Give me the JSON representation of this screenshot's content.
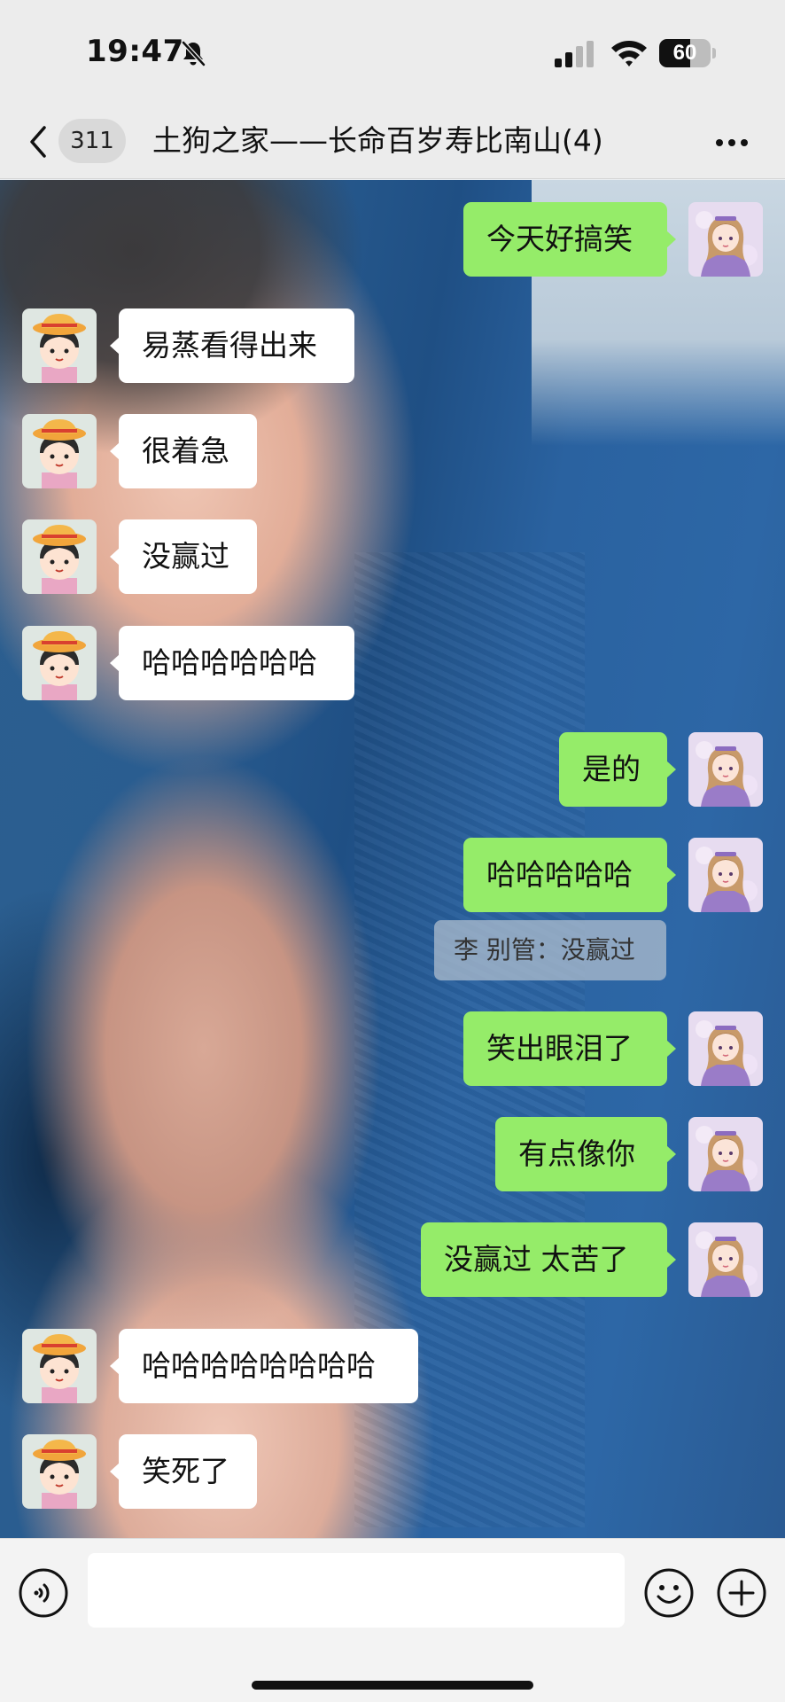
{
  "status_bar": {
    "time": "19:47",
    "battery": "60",
    "battery_level": 0.6
  },
  "header": {
    "unread_count": "311",
    "title": "土狗之家——长命百岁寿比南山(4)"
  },
  "messages": [
    {
      "side": "right",
      "text": "今天好搞笑",
      "avatar": "anime-girl-avatar"
    },
    {
      "side": "left",
      "text": "易蒸看得出来",
      "avatar": "maruko-avatar"
    },
    {
      "side": "left",
      "text": "很着急",
      "avatar": "maruko-avatar"
    },
    {
      "side": "left",
      "text": "没赢过",
      "avatar": "maruko-avatar"
    },
    {
      "side": "left",
      "text": "哈哈哈哈哈哈",
      "avatar": "maruko-avatar"
    },
    {
      "side": "right",
      "text": "是的",
      "avatar": "anime-girl-avatar"
    },
    {
      "side": "right",
      "text": "哈哈哈哈哈",
      "avatar": "anime-girl-avatar"
    },
    {
      "side": "right",
      "text": "笑出眼泪了",
      "avatar": "anime-girl-avatar"
    },
    {
      "side": "right",
      "text": "有点像你",
      "avatar": "anime-girl-avatar"
    },
    {
      "side": "right",
      "text": "没赢过 太苦了",
      "avatar": "anime-girl-avatar"
    },
    {
      "side": "left",
      "text": "哈哈哈哈哈哈哈哈",
      "avatar": "maruko-avatar"
    },
    {
      "side": "left",
      "text": "笑死了",
      "avatar": "maruko-avatar"
    }
  ],
  "quote": {
    "text": "李 别管：没赢过"
  },
  "input_bar": {
    "value": "",
    "placeholder": ""
  },
  "icons": {
    "back": "chevron-left-icon",
    "more": "more-dots-icon",
    "voice": "voice-icon",
    "emoji": "emoji-icon",
    "plus": "plus-icon",
    "mute": "bell-slash-icon",
    "signal": "signal-icon",
    "wifi": "wifi-icon"
  },
  "colors": {
    "sent_bubble": "#95ec69",
    "received_bubble": "#ffffff",
    "bar_background": "#ececec"
  }
}
